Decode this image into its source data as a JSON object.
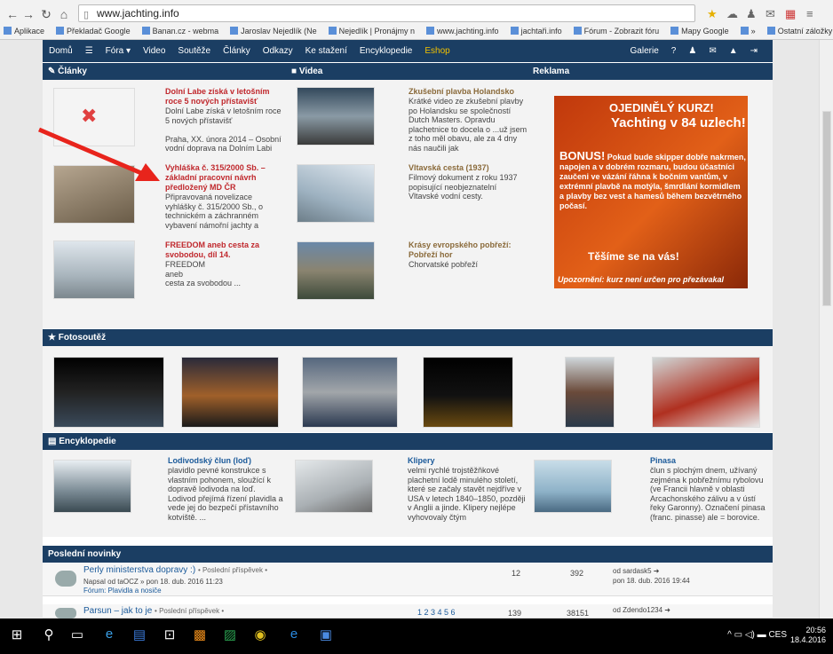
{
  "browser": {
    "url": "www.jachting.info",
    "bookmarks": [
      "Aplikace",
      "Překladač Google",
      "Banan.cz - webma",
      "Jaroslav Nejedlík (Ne",
      "Nejedlík | Pronájmy n",
      "www.jachting.info",
      "jachtaři.info",
      "Fórum - Zobrazit fóru",
      "Mapy Google",
      "»",
      "Ostatní záložky"
    ]
  },
  "nav": {
    "items": [
      "Domů",
      "☰",
      "Fóra ▾",
      "Video",
      "Soutěže",
      "Články",
      "Odkazy",
      "Ke stažení",
      "Encyklopedie",
      "Eshop"
    ],
    "right": [
      "Galerie",
      "?",
      "♟",
      "✉",
      "▲",
      "⇥"
    ]
  },
  "sections": {
    "clanky": "Články",
    "videa": "Videa",
    "reklama": "Reklama",
    "fotosoutez": "Fotosoutěž",
    "encyklopedie": "Encyklopedie",
    "novinky": "Poslední novinky"
  },
  "articles": [
    {
      "title": "Dolní Labe získá v letošním roce 5 nových přístavišť",
      "text": "Dolní Labe získá v letošním roce 5 nových přístavišť\n\nPraha, XX. února 2014 – Osobní vodní doprava na Dolním Labi"
    },
    {
      "title": "Vyhláška č. 315/2000 Sb. – základní pracovní návrh předložený MD ČR",
      "text": "Připravovaná novelizace vyhlášky č. 315/2000 Sb., o technickém a záchranném vybavení námořní jachty a"
    },
    {
      "title": "FREEDOM aneb cesta za svobodou, díl 14.",
      "text": "FREEDOM\naneb\ncesta za svobodou ..."
    }
  ],
  "videos": [
    {
      "title": "Zkušební plavba Holandsko",
      "text": "Krátké video ze zkušební plavby po Holandsku se společností Dutch Masters. Opravdu plachetnice to docela o ...už jsem z toho měl obavu, ale za 4 dny nás naučili jak"
    },
    {
      "title": "Vltavská cesta (1937)",
      "text": "Filmový dokument z roku 1937 popisující neobjeznatelní Vltavské vodní cesty."
    },
    {
      "title": "Krásy evropského pobřeží: Pobřeží hor",
      "text": "Chorvatské pobřeží"
    }
  ],
  "ad": {
    "line1": "OJEDINĚLÝ KURZ!",
    "line2": "Yachting v 84 uzlech!",
    "bonus": "BONUS!",
    "body": "Pokud bude skipper dobře nakrmen, napojen a v dobrém rozmaru, budou účastníci zaučeni ve vázání řáhna k bočním vantům, v extrémní plavbě na motýla, šmrdlání kormidlem a plavby bez vest a hamesů během bezvětrného počasí.",
    "cta": "Těšíme se na vás!",
    "note": "Upozornění: kurz není určen pro přezávakal"
  },
  "encyclopedia": [
    {
      "title": "Lodivodský člun (loď)",
      "text": "plavidlo pevné konstrukce s vlastním pohonem, sloužící k dopravě lodivoda na loď. Lodivod přejímá řízení plavidla a vede jej do bezpečí přístavního kotviště. ..."
    },
    {
      "title": "Klipery",
      "text": "velmi rychlé trojstěžňkové plachetní lodě minulého století, které se začaly stavět nejdříve v USA v letech 1840–1850, později v Anglii a jinde. Klipery nejlépe vyhovovaly čtým"
    },
    {
      "title": "Pinasa",
      "text": "člun s plochým dnem, užívaný zejména k pobřežnímu rybolovu (ve Francii hlavně v oblasti Arcachonského zálivu a v ústí řeky Garonny). Označení pinasa (franc. pinasse) ale = borovice."
    }
  ],
  "news": [
    {
      "title": "Perly ministerstva dopravy :)",
      "tag": "• Poslední příspěvek •",
      "meta": "Napsal od taOCZ » pon 18. dub. 2016 11:23",
      "forum": "Fórum: Plavidla a nosiče",
      "replies": "12",
      "views": "392",
      "last_by": "od sardask5 ➜",
      "last_date": "pon 18. dub. 2016 19:44"
    },
    {
      "title": "Parsun – jak to je",
      "tag": "• Poslední příspěvek •",
      "pages": "1 2 3 4 5 6",
      "replies": "139",
      "views": "38151",
      "last_by": "od Zdendo1234 ➜"
    }
  ],
  "taskbar": {
    "lang": "CES",
    "time": "20:56",
    "date": "18.4.2016"
  }
}
